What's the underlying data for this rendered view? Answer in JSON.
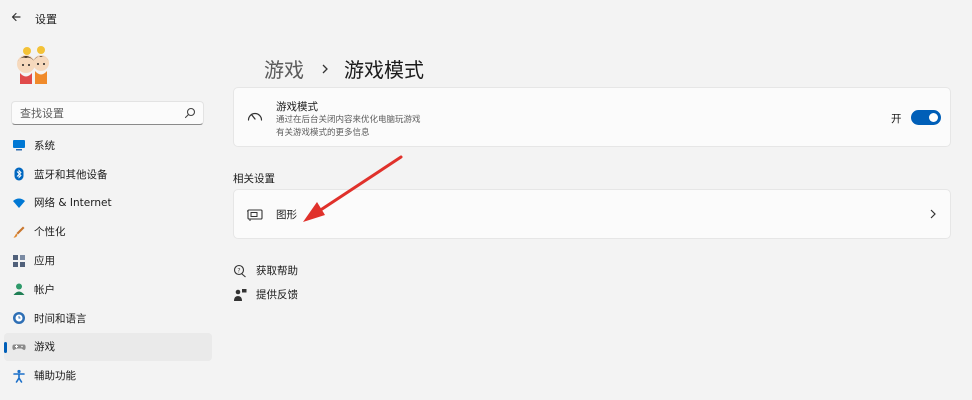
{
  "window": {
    "title": "设置",
    "back_icon": "back-arrow-icon"
  },
  "search": {
    "placeholder": "查找设置",
    "icon": "search-icon"
  },
  "sidebar": {
    "items": [
      {
        "label": "系统",
        "icon": "monitor-icon",
        "color": "#0078d4"
      },
      {
        "label": "蓝牙和其他设备",
        "icon": "bluetooth-icon",
        "color": "#0067c0"
      },
      {
        "label": "网络 & Internet",
        "icon": "wifi-icon",
        "color": "#0078d4"
      },
      {
        "label": "个性化",
        "icon": "brush-icon",
        "color": "#e08a32"
      },
      {
        "label": "应用",
        "icon": "apps-icon",
        "color": "#50607a"
      },
      {
        "label": "帐户",
        "icon": "account-icon",
        "color": "#2e9a6a"
      },
      {
        "label": "时间和语言",
        "icon": "globe-clock-icon",
        "color": "#2e6fb5"
      },
      {
        "label": "游戏",
        "icon": "gamepad-icon",
        "color": "#8a8a8a",
        "selected": true
      },
      {
        "label": "辅助功能",
        "icon": "accessibility-icon",
        "color": "#1a6fc9"
      }
    ]
  },
  "breadcrumb": {
    "parent": "游戏",
    "current": "游戏模式"
  },
  "game_mode": {
    "title": "游戏模式",
    "description": "通过在后台关闭内容来优化电脑玩游戏",
    "link": "有关游戏模式的更多信息",
    "toggle_label": "开",
    "toggle_on": true,
    "icon": "speedometer-icon"
  },
  "related": {
    "title": "相关设置",
    "graphics_label": "图形",
    "graphics_icon": "graphics-card-icon"
  },
  "help": {
    "get_help": "获取帮助",
    "feedback": "提供反馈"
  },
  "colors": {
    "accent": "#005fb8",
    "annotation_arrow": "#e0312b"
  }
}
